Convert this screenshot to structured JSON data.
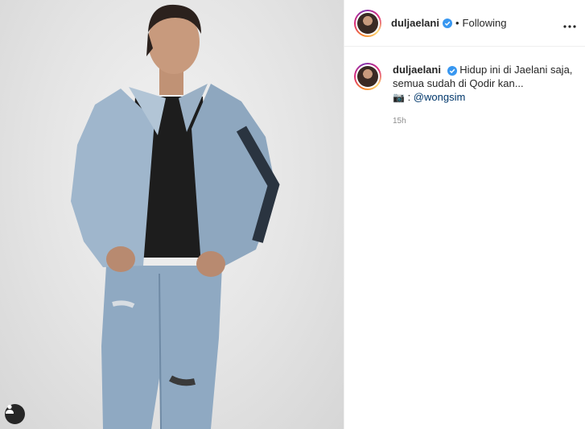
{
  "post": {
    "tag_icon": "person-tag-icon"
  },
  "header": {
    "username": "duljaelani",
    "separator": "•",
    "follow_status": "Following",
    "more_icon": "more-horizontal-icon",
    "verified_icon": "verified-badge-icon"
  },
  "caption": {
    "username": "duljaelani",
    "line1": "Hidup ini di Jaelani saja,",
    "line2": "semua sudah di Qodir kan...",
    "camera_emoji": "📷",
    "credit_prefix": " : ",
    "mention": "@wongsim",
    "time": "15h"
  },
  "colors": {
    "verified_blue": "#3897f0",
    "mention": "#00376b",
    "timestamp": "#8e8e8e"
  }
}
